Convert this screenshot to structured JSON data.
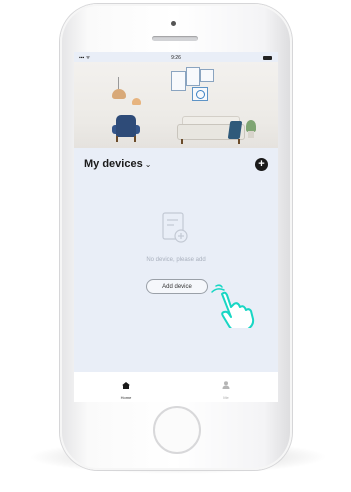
{
  "status_bar": {
    "time": "9:26"
  },
  "header": {
    "title": "My devices",
    "chevron_icon": "chevron-down-icon",
    "add_icon": "plus-icon"
  },
  "empty_state": {
    "icon": "device-add-icon",
    "message": "No device, please add",
    "button_label": "Add device"
  },
  "tab_bar": {
    "tabs": [
      {
        "label": "Home",
        "icon": "home-icon",
        "selected": true
      },
      {
        "label": "Me",
        "icon": "person-icon",
        "selected": false
      }
    ]
  },
  "colors": {
    "screen_bg": "#e9eef7",
    "accent_hand": "#18d6c4"
  }
}
